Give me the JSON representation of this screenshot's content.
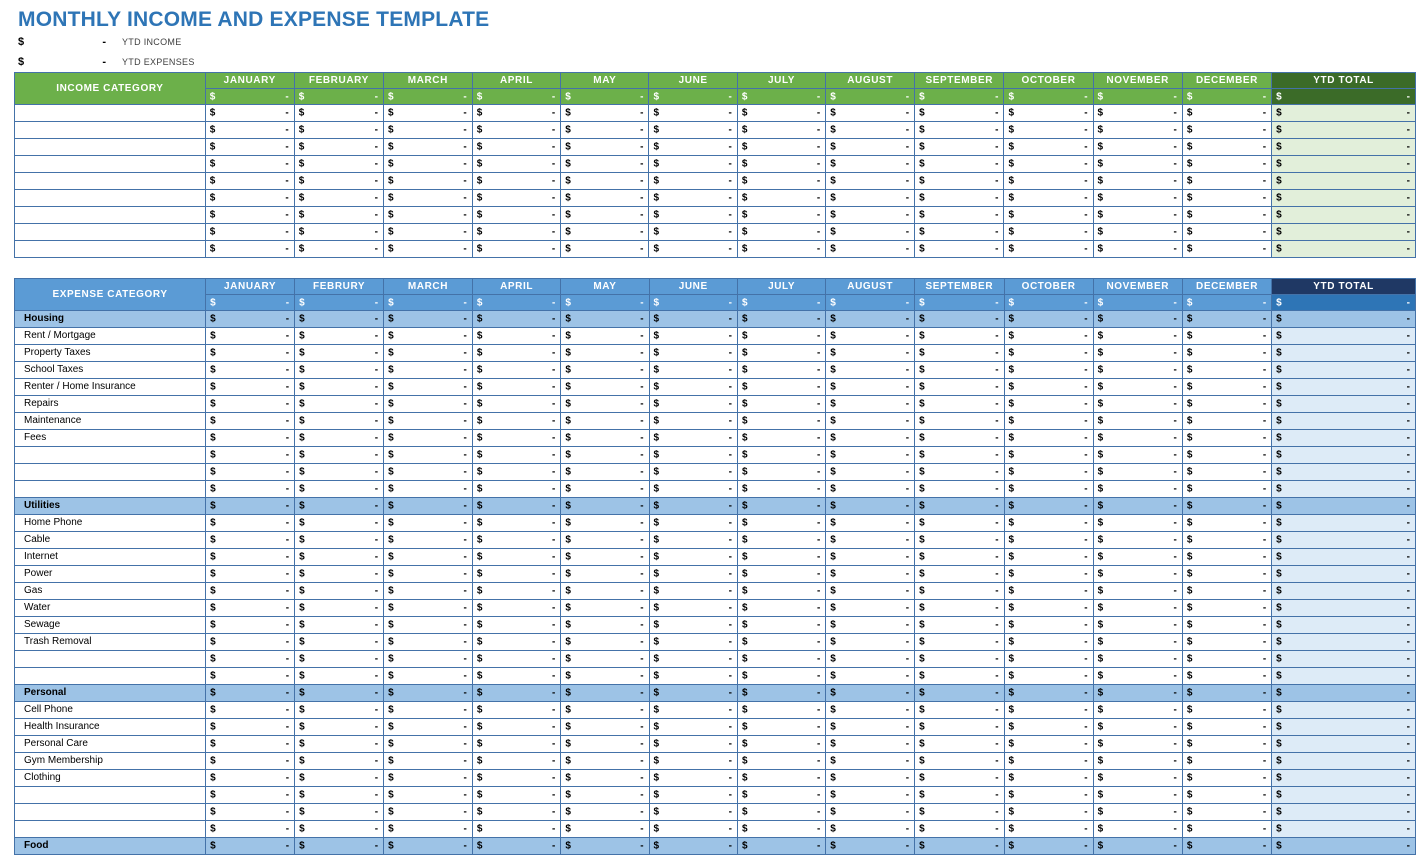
{
  "title": "MONTHLY INCOME AND EXPENSE TEMPLATE",
  "accent_colors": {
    "title_blue": "#2E75B6",
    "income_green": "#6CB04A",
    "income_ytd_green": "#3B6B28",
    "income_ytd_cell": "#E2EFDA",
    "expense_blue": "#5B9BD5",
    "expense_ytd_navy": "#1F3864",
    "expense_group_blue": "#9DC3E6",
    "expense_ytd_cell": "#DDEBF7",
    "gridline": "#4472A8"
  },
  "summary": [
    {
      "symbol": "$",
      "value": "-",
      "label": "YTD INCOME"
    },
    {
      "symbol": "$",
      "value": "-",
      "label": "YTD EXPENSES"
    }
  ],
  "income_table": {
    "category_header": "INCOME CATEGORY",
    "months": [
      "JANUARY",
      "FEBRUARY",
      "MARCH",
      "APRIL",
      "MAY",
      "JUNE",
      "JULY",
      "AUGUST",
      "SEPTEMBER",
      "OCTOBER",
      "NOVEMBER",
      "DECEMBER"
    ],
    "ytd_header": "YTD TOTAL",
    "totals_symbol": "$",
    "totals_value": "-",
    "cell_symbol": "$",
    "cell_value": "-",
    "row_count": 9,
    "rows": [
      {
        "label": ""
      },
      {
        "label": ""
      },
      {
        "label": ""
      },
      {
        "label": ""
      },
      {
        "label": ""
      },
      {
        "label": ""
      },
      {
        "label": ""
      },
      {
        "label": ""
      },
      {
        "label": ""
      }
    ]
  },
  "expense_table": {
    "category_header": "EXPENSE CATEGORY",
    "months": [
      "JANUARY",
      "FEBRURY",
      "MARCH",
      "APRIL",
      "MAY",
      "JUNE",
      "JULY",
      "AUGUST",
      "SEPTEMBER",
      "OCTOBER",
      "NOVEMBER",
      "DECEMBER"
    ],
    "ytd_header": "YTD TOTAL",
    "totals_symbol": "$",
    "totals_value": "-",
    "cell_symbol": "$",
    "cell_value": "-",
    "groups": [
      {
        "name": "Housing",
        "items": [
          "Rent / Mortgage",
          "Property Taxes",
          "School Taxes",
          "Renter / Home Insurance",
          "Repairs",
          "Maintenance",
          "Fees"
        ],
        "blank_rows": 3
      },
      {
        "name": "Utilities",
        "items": [
          "Home Phone",
          "Cable",
          "Internet",
          "Power",
          "Gas",
          "Water",
          "Sewage",
          "Trash Removal"
        ],
        "blank_rows": 2
      },
      {
        "name": "Personal",
        "items": [
          "Cell Phone",
          "Health Insurance",
          "Personal Care",
          "Gym Membership",
          "Clothing"
        ],
        "blank_rows": 3
      },
      {
        "name": "Food",
        "items": [],
        "blank_rows": 0
      }
    ]
  }
}
